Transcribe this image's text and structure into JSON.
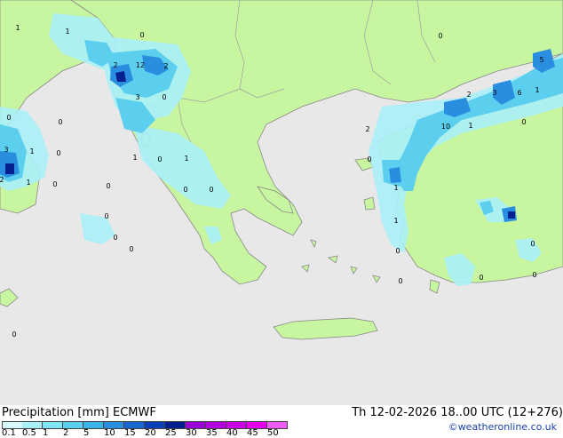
{
  "map": {
    "colors": {
      "sea": "#e8e8e8",
      "land": "#c8f5a0",
      "coast": "#888888",
      "border": "#a0a0a0"
    },
    "value_labels": [
      "1",
      "1",
      "0",
      "2",
      "12",
      "2",
      "3",
      "0",
      "0",
      "0",
      "3",
      "1",
      "0",
      "2",
      "1",
      "0",
      "1",
      "0",
      "1",
      "0",
      "0",
      "0",
      "0",
      "0",
      "0",
      "2",
      "10",
      "1",
      "2",
      "3",
      "6",
      "5",
      "1",
      "0",
      "0",
      "1",
      "1",
      "0",
      "0",
      "0",
      "0",
      "0",
      "0",
      "0"
    ]
  },
  "footer": {
    "title": "Precipitation [mm]  ECMWF",
    "valid_time": "Th 12-02-2026 18..00 UTC (12+276)",
    "credit": "©weatheronline.co.uk",
    "legend": {
      "ticks": [
        "0.1",
        "0.5",
        "1",
        "2",
        "5",
        "10",
        "15",
        "20",
        "25",
        "30",
        "35",
        "40",
        "45",
        "50"
      ],
      "colors": [
        "#d4f8fb",
        "#aaf0f8",
        "#80e6f5",
        "#5ccfee",
        "#3ab4e6",
        "#2a8ee0",
        "#1a66d0",
        "#0c40b8",
        "#04208f",
        "#9a00d8",
        "#b400e0",
        "#cc00e6",
        "#e200ee",
        "#f05cf8"
      ]
    }
  }
}
